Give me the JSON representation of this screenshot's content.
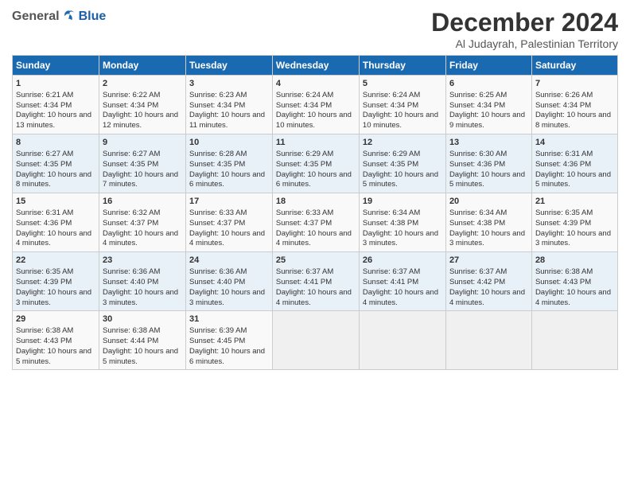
{
  "header": {
    "logo_general": "General",
    "logo_blue": "Blue",
    "title": "December 2024",
    "subtitle": "Al Judayrah, Palestinian Territory"
  },
  "columns": [
    "Sunday",
    "Monday",
    "Tuesday",
    "Wednesday",
    "Thursday",
    "Friday",
    "Saturday"
  ],
  "weeks": [
    [
      {
        "day": "1",
        "sunrise": "Sunrise: 6:21 AM",
        "sunset": "Sunset: 4:34 PM",
        "daylight": "Daylight: 10 hours and 13 minutes."
      },
      {
        "day": "2",
        "sunrise": "Sunrise: 6:22 AM",
        "sunset": "Sunset: 4:34 PM",
        "daylight": "Daylight: 10 hours and 12 minutes."
      },
      {
        "day": "3",
        "sunrise": "Sunrise: 6:23 AM",
        "sunset": "Sunset: 4:34 PM",
        "daylight": "Daylight: 10 hours and 11 minutes."
      },
      {
        "day": "4",
        "sunrise": "Sunrise: 6:24 AM",
        "sunset": "Sunset: 4:34 PM",
        "daylight": "Daylight: 10 hours and 10 minutes."
      },
      {
        "day": "5",
        "sunrise": "Sunrise: 6:24 AM",
        "sunset": "Sunset: 4:34 PM",
        "daylight": "Daylight: 10 hours and 10 minutes."
      },
      {
        "day": "6",
        "sunrise": "Sunrise: 6:25 AM",
        "sunset": "Sunset: 4:34 PM",
        "daylight": "Daylight: 10 hours and 9 minutes."
      },
      {
        "day": "7",
        "sunrise": "Sunrise: 6:26 AM",
        "sunset": "Sunset: 4:34 PM",
        "daylight": "Daylight: 10 hours and 8 minutes."
      }
    ],
    [
      {
        "day": "8",
        "sunrise": "Sunrise: 6:27 AM",
        "sunset": "Sunset: 4:35 PM",
        "daylight": "Daylight: 10 hours and 8 minutes."
      },
      {
        "day": "9",
        "sunrise": "Sunrise: 6:27 AM",
        "sunset": "Sunset: 4:35 PM",
        "daylight": "Daylight: 10 hours and 7 minutes."
      },
      {
        "day": "10",
        "sunrise": "Sunrise: 6:28 AM",
        "sunset": "Sunset: 4:35 PM",
        "daylight": "Daylight: 10 hours and 6 minutes."
      },
      {
        "day": "11",
        "sunrise": "Sunrise: 6:29 AM",
        "sunset": "Sunset: 4:35 PM",
        "daylight": "Daylight: 10 hours and 6 minutes."
      },
      {
        "day": "12",
        "sunrise": "Sunrise: 6:29 AM",
        "sunset": "Sunset: 4:35 PM",
        "daylight": "Daylight: 10 hours and 5 minutes."
      },
      {
        "day": "13",
        "sunrise": "Sunrise: 6:30 AM",
        "sunset": "Sunset: 4:36 PM",
        "daylight": "Daylight: 10 hours and 5 minutes."
      },
      {
        "day": "14",
        "sunrise": "Sunrise: 6:31 AM",
        "sunset": "Sunset: 4:36 PM",
        "daylight": "Daylight: 10 hours and 5 minutes."
      }
    ],
    [
      {
        "day": "15",
        "sunrise": "Sunrise: 6:31 AM",
        "sunset": "Sunset: 4:36 PM",
        "daylight": "Daylight: 10 hours and 4 minutes."
      },
      {
        "day": "16",
        "sunrise": "Sunrise: 6:32 AM",
        "sunset": "Sunset: 4:37 PM",
        "daylight": "Daylight: 10 hours and 4 minutes."
      },
      {
        "day": "17",
        "sunrise": "Sunrise: 6:33 AM",
        "sunset": "Sunset: 4:37 PM",
        "daylight": "Daylight: 10 hours and 4 minutes."
      },
      {
        "day": "18",
        "sunrise": "Sunrise: 6:33 AM",
        "sunset": "Sunset: 4:37 PM",
        "daylight": "Daylight: 10 hours and 4 minutes."
      },
      {
        "day": "19",
        "sunrise": "Sunrise: 6:34 AM",
        "sunset": "Sunset: 4:38 PM",
        "daylight": "Daylight: 10 hours and 3 minutes."
      },
      {
        "day": "20",
        "sunrise": "Sunrise: 6:34 AM",
        "sunset": "Sunset: 4:38 PM",
        "daylight": "Daylight: 10 hours and 3 minutes."
      },
      {
        "day": "21",
        "sunrise": "Sunrise: 6:35 AM",
        "sunset": "Sunset: 4:39 PM",
        "daylight": "Daylight: 10 hours and 3 minutes."
      }
    ],
    [
      {
        "day": "22",
        "sunrise": "Sunrise: 6:35 AM",
        "sunset": "Sunset: 4:39 PM",
        "daylight": "Daylight: 10 hours and 3 minutes."
      },
      {
        "day": "23",
        "sunrise": "Sunrise: 6:36 AM",
        "sunset": "Sunset: 4:40 PM",
        "daylight": "Daylight: 10 hours and 3 minutes."
      },
      {
        "day": "24",
        "sunrise": "Sunrise: 6:36 AM",
        "sunset": "Sunset: 4:40 PM",
        "daylight": "Daylight: 10 hours and 3 minutes."
      },
      {
        "day": "25",
        "sunrise": "Sunrise: 6:37 AM",
        "sunset": "Sunset: 4:41 PM",
        "daylight": "Daylight: 10 hours and 4 minutes."
      },
      {
        "day": "26",
        "sunrise": "Sunrise: 6:37 AM",
        "sunset": "Sunset: 4:41 PM",
        "daylight": "Daylight: 10 hours and 4 minutes."
      },
      {
        "day": "27",
        "sunrise": "Sunrise: 6:37 AM",
        "sunset": "Sunset: 4:42 PM",
        "daylight": "Daylight: 10 hours and 4 minutes."
      },
      {
        "day": "28",
        "sunrise": "Sunrise: 6:38 AM",
        "sunset": "Sunset: 4:43 PM",
        "daylight": "Daylight: 10 hours and 4 minutes."
      }
    ],
    [
      {
        "day": "29",
        "sunrise": "Sunrise: 6:38 AM",
        "sunset": "Sunset: 4:43 PM",
        "daylight": "Daylight: 10 hours and 5 minutes."
      },
      {
        "day": "30",
        "sunrise": "Sunrise: 6:38 AM",
        "sunset": "Sunset: 4:44 PM",
        "daylight": "Daylight: 10 hours and 5 minutes."
      },
      {
        "day": "31",
        "sunrise": "Sunrise: 6:39 AM",
        "sunset": "Sunset: 4:45 PM",
        "daylight": "Daylight: 10 hours and 6 minutes."
      },
      null,
      null,
      null,
      null
    ]
  ]
}
